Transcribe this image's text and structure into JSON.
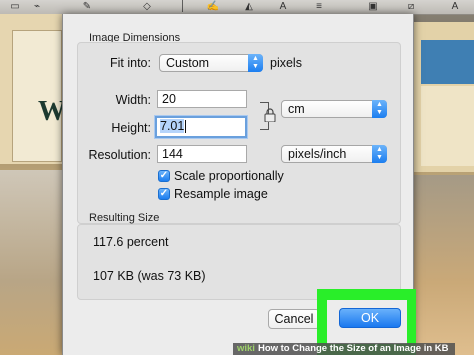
{
  "dialog": {
    "dimensions_title": "Image Dimensions",
    "fit_into": {
      "label": "Fit into:",
      "value": "Custom",
      "unit": "pixels"
    },
    "width": {
      "label": "Width:",
      "value": "20"
    },
    "height": {
      "label": "Height:",
      "value": "7.01"
    },
    "size_unit": "cm",
    "resolution": {
      "label": "Resolution:",
      "value": "144",
      "unit": "pixels/inch"
    },
    "scale_proportionally": {
      "label": "Scale proportionally",
      "checked": true
    },
    "resample_image": {
      "label": "Resample image",
      "checked": true
    },
    "resulting_size_title": "Resulting Size",
    "percent": "117.6 percent",
    "file_size": "107 KB (was 73 KB)",
    "cancel_label": "Cancel",
    "ok_label": "OK"
  },
  "highlight_color": "#29ee29",
  "accent_color": "#1a78ef",
  "watermark": {
    "brand": "wiki",
    "text": "How to Change the Size of an Image in KB"
  }
}
